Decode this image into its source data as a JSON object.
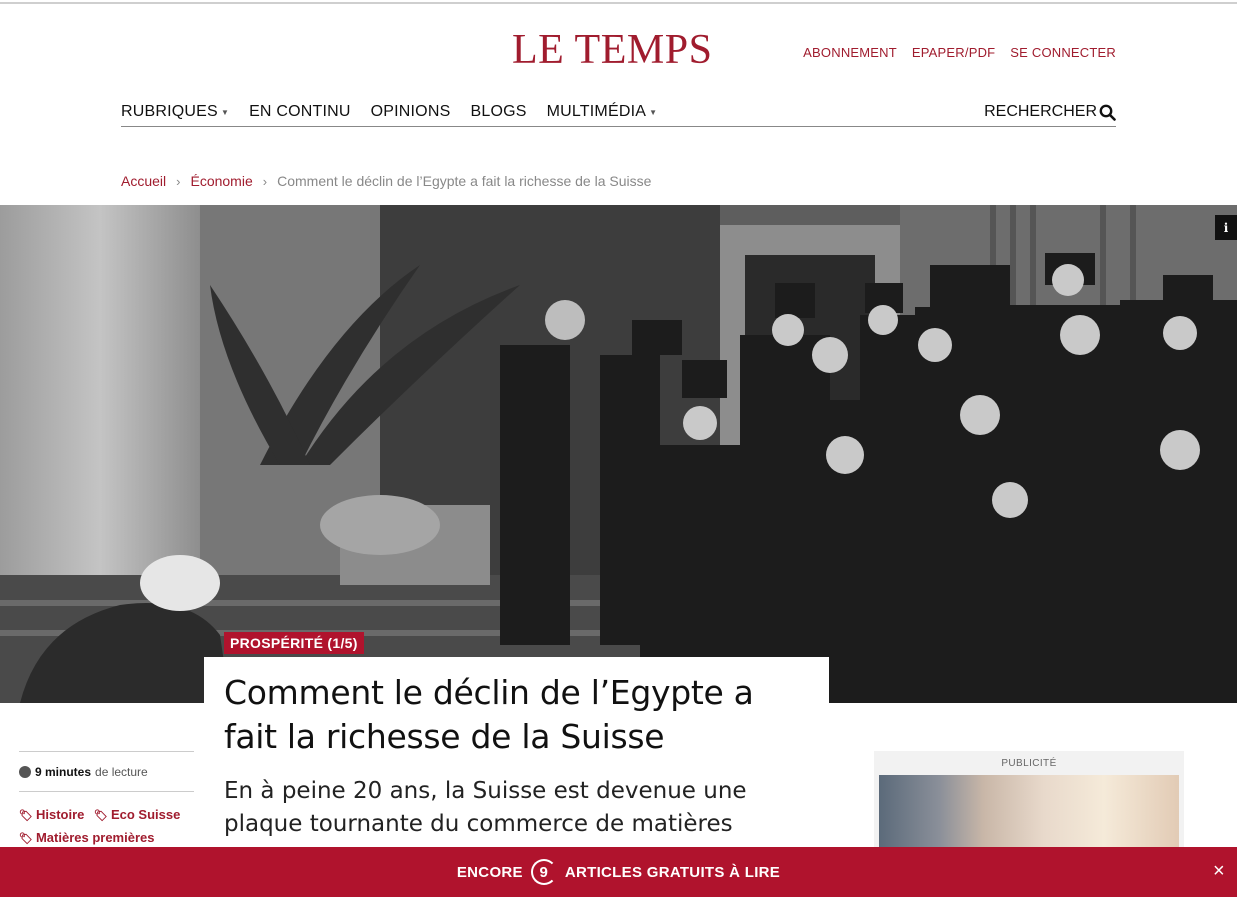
{
  "brand": {
    "logo": "LE TEMPS"
  },
  "account_links": [
    "ABONNEMENT",
    "EPAPER/PDF",
    "SE CONNECTER"
  ],
  "nav": {
    "items": [
      {
        "label": "RUBRIQUES",
        "dropdown": true
      },
      {
        "label": "EN CONTINU",
        "dropdown": false
      },
      {
        "label": "OPINIONS",
        "dropdown": false
      },
      {
        "label": "BLOGS",
        "dropdown": false
      },
      {
        "label": "MULTIMÉDIA",
        "dropdown": true
      }
    ],
    "search_label": "RECHERCHER"
  },
  "breadcrumb": {
    "home": "Accueil",
    "section": "Économie",
    "current": "Comment le déclin de l’Egypte a fait la richesse de la Suisse",
    "separator": "›"
  },
  "article": {
    "kicker": "PROSPÉRITÉ (1/5)",
    "title": "Comment le déclin de l’Egypte a fait la richesse de la Suisse",
    "lead": "En à peine 20 ans, la Suisse est devenue une plaque tournante du commerce de matières",
    "reading_time_value": "9 minutes",
    "reading_time_suffix": "de lecture",
    "tags": [
      "Histoire",
      "Eco Suisse",
      "Matières premières"
    ],
    "info_icon": "i"
  },
  "ad": {
    "label": "PUBLICITÉ"
  },
  "paywall": {
    "prefix": "ENCORE",
    "count": "9",
    "suffix": "ARTICLES GRATUITS À LIRE",
    "close": "×"
  },
  "colors": {
    "brand": "#a01c2e",
    "banner": "#b0132d"
  }
}
